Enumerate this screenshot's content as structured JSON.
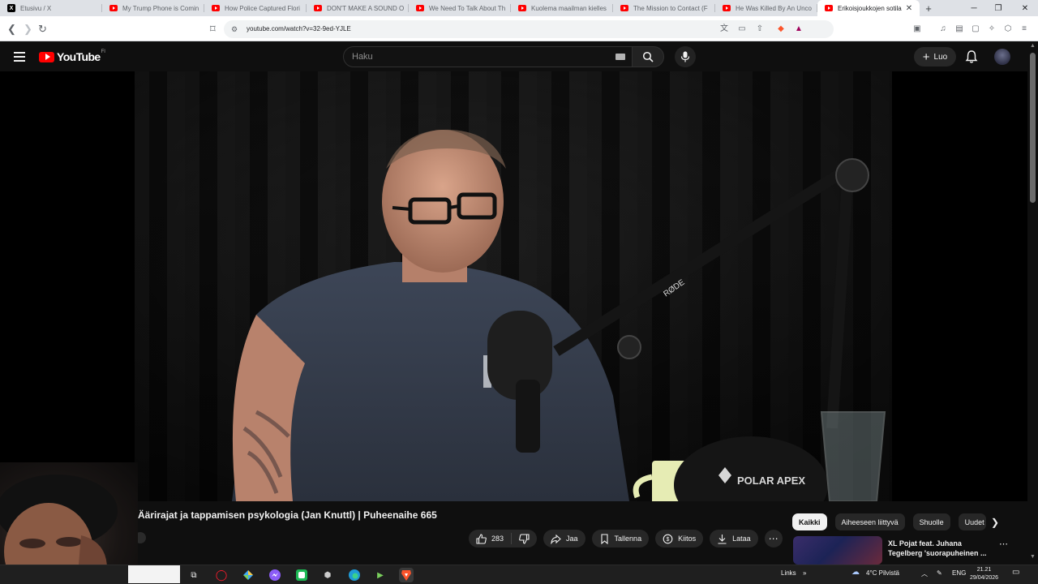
{
  "browser": {
    "tabs": [
      {
        "title": "Etusivu / X",
        "favicon": "x-logo-icon",
        "active": false
      },
      {
        "title": "My Trump Phone is Comin",
        "favicon": "youtube-icon",
        "active": false
      },
      {
        "title": "How Police Captured Flori",
        "favicon": "youtube-icon",
        "active": false
      },
      {
        "title": "DON'T MAKE A SOUND O",
        "favicon": "youtube-icon",
        "active": false
      },
      {
        "title": "We Need To Talk About Th",
        "favicon": "youtube-icon",
        "active": false
      },
      {
        "title": "Kuolema maailman kielles",
        "favicon": "youtube-icon",
        "active": false
      },
      {
        "title": "The Mission to Contact (F",
        "favicon": "youtube-icon",
        "active": false
      },
      {
        "title": "He Was Killed By An Unco",
        "favicon": "youtube-icon",
        "active": false
      },
      {
        "title": "Erikoisjoukkojen sotila",
        "favicon": "youtube-icon",
        "active": true
      }
    ],
    "url": "youtube.com/watch?v=32-9ed-YJLE"
  },
  "youtube": {
    "logo_text": "YouTube",
    "country_code": "FI",
    "search_placeholder": "Haku",
    "create_label": "Luo"
  },
  "video": {
    "title": "Äärirajat ja tappamisen psykologia (Jan Knuttl) | Puheenaihe 665",
    "likes": "283",
    "share_label": "Jaa",
    "save_label": "Tallenna",
    "thanks_label": "Kiitos",
    "download_label": "Lataa"
  },
  "chips": [
    "Kaikki",
    "Aiheeseen liittyvä",
    "Shuolle",
    "Uudet"
  ],
  "recommended": {
    "title": "XL Pojat feat. Juhana Tegelberg 'suorapuheinen ..."
  },
  "video_scene": {
    "mug_text": "POLAR APEX",
    "mic_brand": "RØDE"
  },
  "taskbar": {
    "links_label": "Links",
    "weather": "4°C  Pilvistä",
    "language": "ENG",
    "time": "21.21",
    "date": "29/04/2026"
  }
}
